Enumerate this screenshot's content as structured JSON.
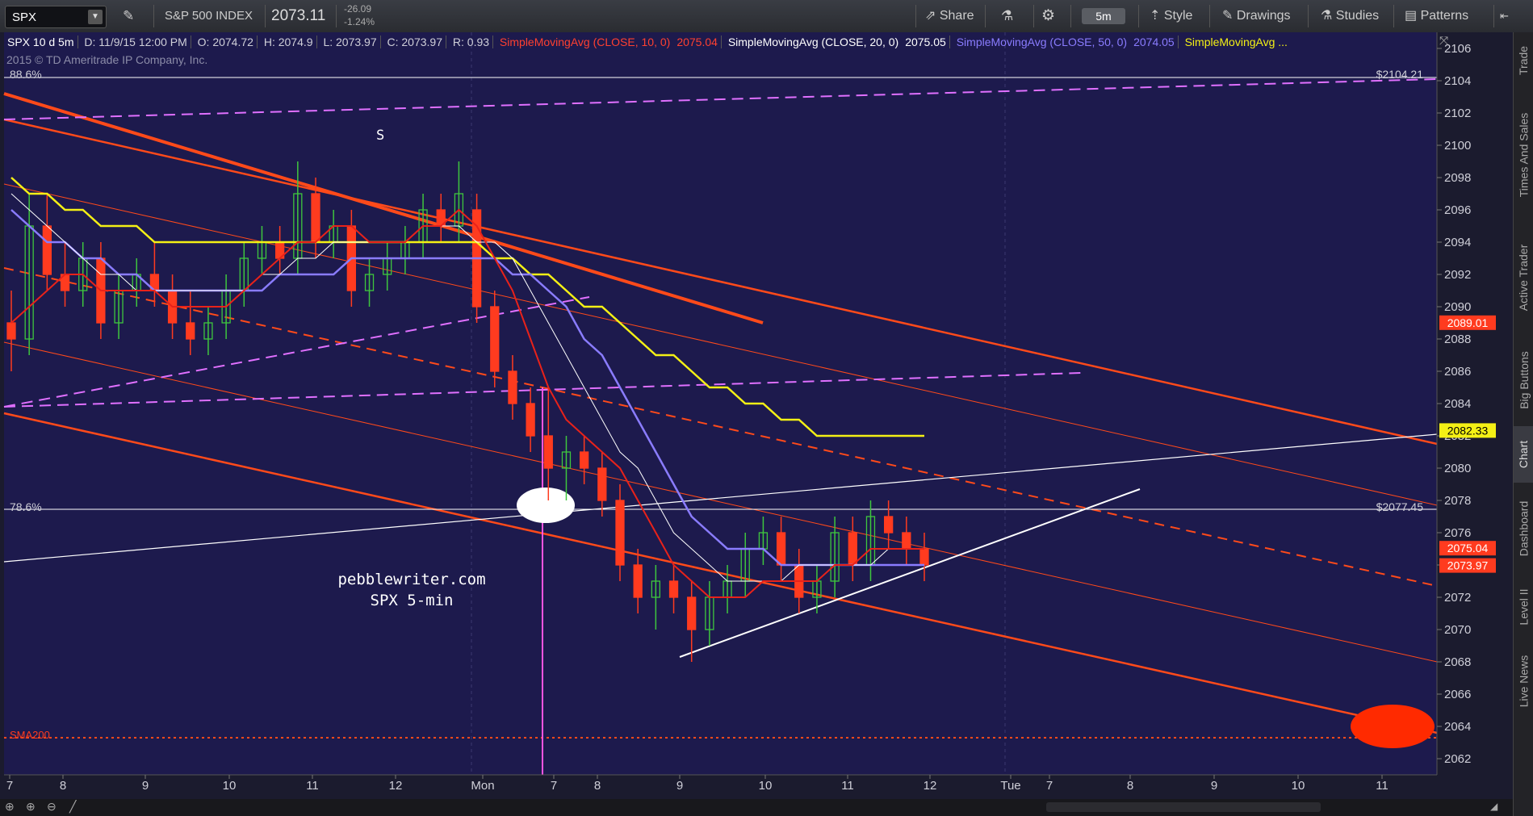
{
  "toolbar": {
    "symbol": "SPX",
    "index_name": "S&P 500 INDEX",
    "last_price": "2073.11",
    "change": "-26.09",
    "change_pct": "-1.24%",
    "share_label": "Share",
    "interval_label": "5m",
    "style_label": "Style",
    "drawings_label": "Drawings",
    "studies_label": "Studies",
    "patterns_label": "Patterns"
  },
  "info_bar": {
    "title": "SPX 10 d 5m",
    "date": "D: 11/9/15 12:00 PM",
    "open": "O: 2074.72",
    "high": "H: 2074.9",
    "low": "L: 2073.97",
    "close": "C: 2073.97",
    "range": "R: 0.93",
    "sma10_label": "SimpleMovingAvg (CLOSE, 10, 0)",
    "sma10_value": "2075.04",
    "sma20_label": "SimpleMovingAvg (CLOSE, 20, 0)",
    "sma20_value": "2075.05",
    "sma50_label": "SimpleMovingAvg (CLOSE, 50, 0)",
    "sma50_value": "2074.05",
    "sma_more_label": "SimpleMovingAvg ..."
  },
  "copyright": "2015 © TD Ameritrade IP Company, Inc.",
  "right_tabs": [
    "Trade",
    "Times And Sales",
    "Active Trader",
    "Big Buttons",
    "Chart",
    "Dashboard",
    "Level II",
    "Live News"
  ],
  "colors": {
    "background": "#1d1a4d",
    "up_candle": "#3ec63e",
    "down_candle": "#ff3b1f",
    "sma10": "#e8221a",
    "sma20": "#ffffff",
    "sma50": "#8a7cff",
    "sma_yellow": "#f4f015",
    "channel": "#ff4a1a",
    "fib_line": "#ffffff",
    "pink_dashed": "#e070ff"
  },
  "chart_data": {
    "type": "candlestick",
    "y_axis": {
      "min": 2061,
      "max": 2107,
      "ticks": [
        2062,
        2064,
        2066,
        2068,
        2070,
        2072,
        2074,
        2076,
        2078,
        2080,
        2082,
        2084,
        2086,
        2088,
        2090,
        2092,
        2094,
        2096,
        2098,
        2100,
        2102,
        2104,
        2106
      ]
    },
    "x_tick_labels": [
      "7",
      "8",
      "9",
      "10",
      "11",
      "12",
      "Mon",
      "7",
      "8",
      "9",
      "10",
      "11",
      "12",
      "Tue",
      "7",
      "8",
      "9",
      "10",
      "11"
    ],
    "annotations": {
      "watermark_line1": "pebblewriter.com",
      "watermark_line2": "SPX 5-min",
      "s_marker": "S",
      "fib_886": "88.6%",
      "fib_886_price": "$2104.21",
      "fib_786": "78.6%",
      "fib_786_price": "$2077.45",
      "sma200_label": "SMA200"
    },
    "price_labels": [
      {
        "value": 2089.01,
        "text": "2089.01",
        "color": "#ff3b1f"
      },
      {
        "value": 2082.33,
        "text": "2082.33",
        "color": "#f4f015"
      },
      {
        "value": 2075.04,
        "text": "2075.04",
        "color": "#ff3b1f"
      },
      {
        "value": 2073.97,
        "text": "2073.97",
        "color": "#ff3b1f"
      }
    ],
    "fib_levels": [
      2104.21,
      2077.45
    ],
    "sma200_level": 2063.3,
    "ohlc": [
      [
        2089,
        2091,
        2086,
        2088
      ],
      [
        2088,
        2097,
        2087,
        2095
      ],
      [
        2095,
        2097,
        2091,
        2092
      ],
      [
        2092,
        2094,
        2090,
        2091
      ],
      [
        2091,
        2094,
        2090,
        2093
      ],
      [
        2093,
        2094,
        2088,
        2089
      ],
      [
        2089,
        2092,
        2088,
        2091
      ],
      [
        2091,
        2093,
        2090,
        2092
      ],
      [
        2092,
        2094,
        2090,
        2091
      ],
      [
        2091,
        2092,
        2088,
        2089
      ],
      [
        2089,
        2091,
        2087,
        2088
      ],
      [
        2088,
        2090,
        2087,
        2089
      ],
      [
        2089,
        2092,
        2088,
        2091
      ],
      [
        2091,
        2094,
        2090,
        2093
      ],
      [
        2093,
        2095,
        2092,
        2094
      ],
      [
        2094,
        2095,
        2092,
        2093
      ],
      [
        2093,
        2099,
        2092,
        2097
      ],
      [
        2097,
        2098,
        2093,
        2094
      ],
      [
        2094,
        2096,
        2093,
        2095
      ],
      [
        2095,
        2096,
        2090,
        2091
      ],
      [
        2091,
        2093,
        2090,
        2092
      ],
      [
        2092,
        2094,
        2091,
        2093
      ],
      [
        2093,
        2095,
        2092,
        2094
      ],
      [
        2094,
        2097,
        2093,
        2096
      ],
      [
        2096,
        2097,
        2094,
        2095
      ],
      [
        2095,
        2099,
        2094,
        2097
      ],
      [
        2096,
        2097,
        2089,
        2090
      ],
      [
        2090,
        2091,
        2085,
        2086
      ],
      [
        2086,
        2087,
        2083,
        2084
      ],
      [
        2084,
        2085,
        2081,
        2082
      ],
      [
        2082,
        2085,
        2078,
        2080
      ],
      [
        2080,
        2082,
        2078,
        2081
      ],
      [
        2081,
        2082,
        2079,
        2080
      ],
      [
        2080,
        2081,
        2077,
        2078
      ],
      [
        2078,
        2079,
        2073,
        2074
      ],
      [
        2074,
        2075,
        2071,
        2072
      ],
      [
        2072,
        2074,
        2070,
        2073
      ],
      [
        2073,
        2074,
        2071,
        2072
      ],
      [
        2072,
        2073,
        2068,
        2070
      ],
      [
        2070,
        2073,
        2069,
        2072
      ],
      [
        2072,
        2074,
        2071,
        2073
      ],
      [
        2073,
        2076,
        2072,
        2075
      ],
      [
        2075,
        2077,
        2074,
        2076
      ],
      [
        2076,
        2077,
        2073,
        2074
      ],
      [
        2074,
        2075,
        2071,
        2072
      ],
      [
        2072,
        2074,
        2071,
        2073
      ],
      [
        2073,
        2077,
        2072,
        2076
      ],
      [
        2076,
        2077,
        2073,
        2074
      ],
      [
        2074,
        2078,
        2073,
        2077
      ],
      [
        2077,
        2078,
        2075,
        2076
      ],
      [
        2076,
        2077,
        2074,
        2075
      ],
      [
        2075,
        2076,
        2073,
        2074
      ]
    ],
    "sma10": [
      2089,
      2090,
      2091,
      2092,
      2092,
      2091,
      2091,
      2091,
      2091,
      2090,
      2090,
      2090,
      2090,
      2091,
      2092,
      2093,
      2094,
      2094,
      2095,
      2095,
      2094,
      2094,
      2094,
      2095,
      2095,
      2096,
      2095,
      2093,
      2091,
      2088,
      2085,
      2083,
      2082,
      2081,
      2080,
      2078,
      2076,
      2074,
      2073,
      2072,
      2072,
      2072,
      2073,
      2073,
      2073,
      2073,
      2074,
      2074,
      2075,
      2075,
      2075,
      2075
    ],
    "sma20": [
      2097,
      2096,
      2095,
      2094,
      2093,
      2092,
      2092,
      2091,
      2091,
      2091,
      2091,
      2091,
      2091,
      2091,
      2092,
      2092,
      2093,
      2093,
      2094,
      2094,
      2094,
      2094,
      2094,
      2095,
      2095,
      2095,
      2094,
      2094,
      2093,
      2091,
      2089,
      2087,
      2085,
      2083,
      2081,
      2080,
      2078,
      2076,
      2075,
      2074,
      2073,
      2073,
      2073,
      2073,
      2074,
      2074,
      2074,
      2074,
      2074,
      2075,
      2075,
      2075
    ],
    "sma50": [
      2096,
      2095,
      2094,
      2094,
      2093,
      2093,
      2092,
      2092,
      2091,
      2091,
      2091,
      2091,
      2091,
      2091,
      2091,
      2092,
      2092,
      2092,
      2092,
      2093,
      2093,
      2093,
      2093,
      2093,
      2093,
      2093,
      2093,
      2093,
      2092,
      2092,
      2091,
      2090,
      2088,
      2087,
      2085,
      2083,
      2081,
      2079,
      2077,
      2076,
      2075,
      2075,
      2075,
      2074,
      2074,
      2074,
      2074,
      2074,
      2074,
      2074,
      2074,
      2074
    ],
    "sma_yellow": [
      2098,
      2097,
      2097,
      2096,
      2096,
      2095,
      2095,
      2095,
      2094,
      2094,
      2094,
      2094,
      2094,
      2094,
      2094,
      2094,
      2094,
      2094,
      2094,
      2094,
      2094,
      2094,
      2094,
      2094,
      2094,
      2094,
      2094,
      2093,
      2093,
      2092,
      2092,
      2091,
      2090,
      2090,
      2089,
      2088,
      2087,
      2087,
      2086,
      2085,
      2085,
      2084,
      2084,
      2083,
      2083,
      2082,
      2082,
      2082,
      2082,
      2082,
      2082,
      2082
    ]
  }
}
